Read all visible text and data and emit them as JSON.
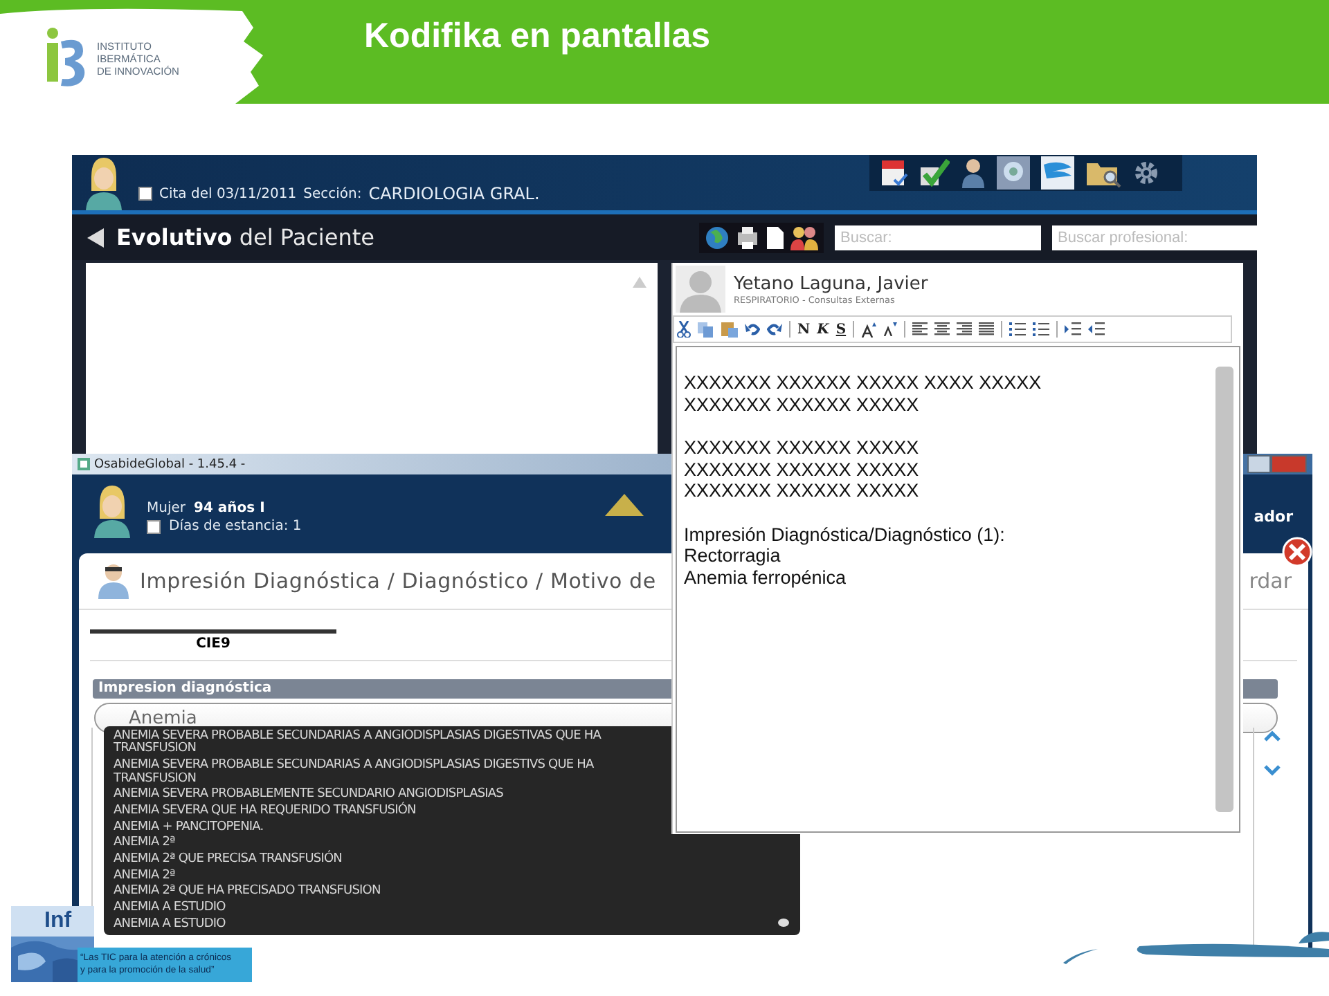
{
  "slide": {
    "title": "Kodifika en pantallas",
    "logo_lines": [
      "INSTITUTO",
      "IBERMÁTICA",
      "DE INNOVACIÓN"
    ],
    "footer_banner": {
      "short": "Inf",
      "lines": [
        "“Las TIC para la atención a crónicos",
        "y para la promoción de la salud”"
      ]
    }
  },
  "back_window": {
    "appointment_checked": false,
    "appointment": "Cita del 03/11/2011",
    "section_label": "Sección:",
    "section": "CARDIOLOGIA GRAL.",
    "panel_title": "**Evolutivo** del Paciente",
    "search_placeholder": "Buscar:",
    "professional_placeholder": "Buscar profesional:"
  },
  "front_window": {
    "title": "OsabideGlobal - 1.45.4 -",
    "patient": {
      "sex": "Mujer",
      "age": "94 años I",
      "stay_checked": false,
      "stay": "Días de estancia: 1"
    },
    "header_right": "ador",
    "dialog": {
      "title": "Impresión Diagnóstica / Diagnóstico / Motivo de",
      "action": "rdar",
      "tab": "CIE9",
      "section": "Impresion diagnóstica",
      "search_value": "Anemia",
      "suggestions": [
        {
          "lines": [
            "ANEMIA SEVERA PROBABLE SECUNDARIAS A ANGIODISPLASIAS DIGESTIVAS QUE HA",
            "TRANSFUSION"
          ]
        },
        {
          "lines": [
            "ANEMIA SEVERA PROBABLE SECUNDARIAS A ANGIODISPLASIAS DIGESTIVS QUE HA",
            "TRANSFUSION"
          ]
        },
        {
          "lines": [
            "ANEMIA SEVERA PROBABLEMENTE SECUNDARIO ANGIODISPLASIAS"
          ]
        },
        {
          "lines": [
            "ANEMIA SEVERA QUE HA REQUERIDO TRANSFUSIÓN"
          ]
        },
        {
          "lines": [
            "ANEMIA + PANCITOPENIA."
          ]
        },
        {
          "lines": [
            "ANEMIA 2ª"
          ]
        },
        {
          "lines": [
            "ANEMIA 2ª QUE PRECISA TRANSFUSIÓN"
          ]
        },
        {
          "lines": [
            "ANEMIA 2ª"
          ]
        },
        {
          "lines": [
            "ANEMIA 2ª QUE HA PRECISADO TRANSFUSION"
          ]
        },
        {
          "lines": [
            "ANEMIA A ESTUDIO"
          ]
        },
        {
          "lines": [
            "ANEMIA A ESTUDIO"
          ]
        }
      ]
    }
  },
  "editor": {
    "name": "Yetano Laguna, Javier",
    "service": "RESPIRATORIO - Consultas Externas",
    "format_buttons": [
      "N",
      "K",
      "S"
    ],
    "paragraphs": [
      [
        "XXXXXXX XXXXXX XXXXX XXXX XXXXX",
        "XXXXXXX XXXXXX XXXXX"
      ],
      [
        "XXXXXXX XXXXXX XXXXX",
        "XXXXXXX XXXXXX XXXXX",
        "XXXXXXX XXXXXX XXXXX"
      ],
      [
        "Impresión Diagnóstica/Diagnóstico (1):",
        "Rectorragia",
        "Anemia ferropénica"
      ]
    ]
  }
}
